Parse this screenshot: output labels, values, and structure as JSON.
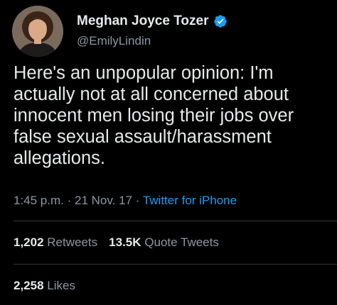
{
  "author": {
    "display_name": "Meghan Joyce Tozer",
    "handle": "@EmilyLindin",
    "avatar_icon": "user-avatar",
    "verified_icon": "verified-badge-icon"
  },
  "tweet": {
    "text": "Here's an unpopular opinion: I'm\nactually not at all concerned about\ninnocent men losing their jobs over\nfalse sexual assault/harassment\nallegations.",
    "time": "1:45 p.m.",
    "separator": "·",
    "date": "21 Nov. 17",
    "source": "Twitter for iPhone"
  },
  "stats": {
    "retweets_count": "1,202",
    "retweets_label": "Retweets",
    "quote_count": "13.5K",
    "quote_label": "Quote Tweets",
    "likes_count": "2,258",
    "likes_label": "Likes"
  },
  "colors": {
    "background": "#000000",
    "text": "#e7e9ea",
    "secondary": "#8b98a5",
    "accent": "#1d9bf0",
    "divider": "#2f3336"
  }
}
